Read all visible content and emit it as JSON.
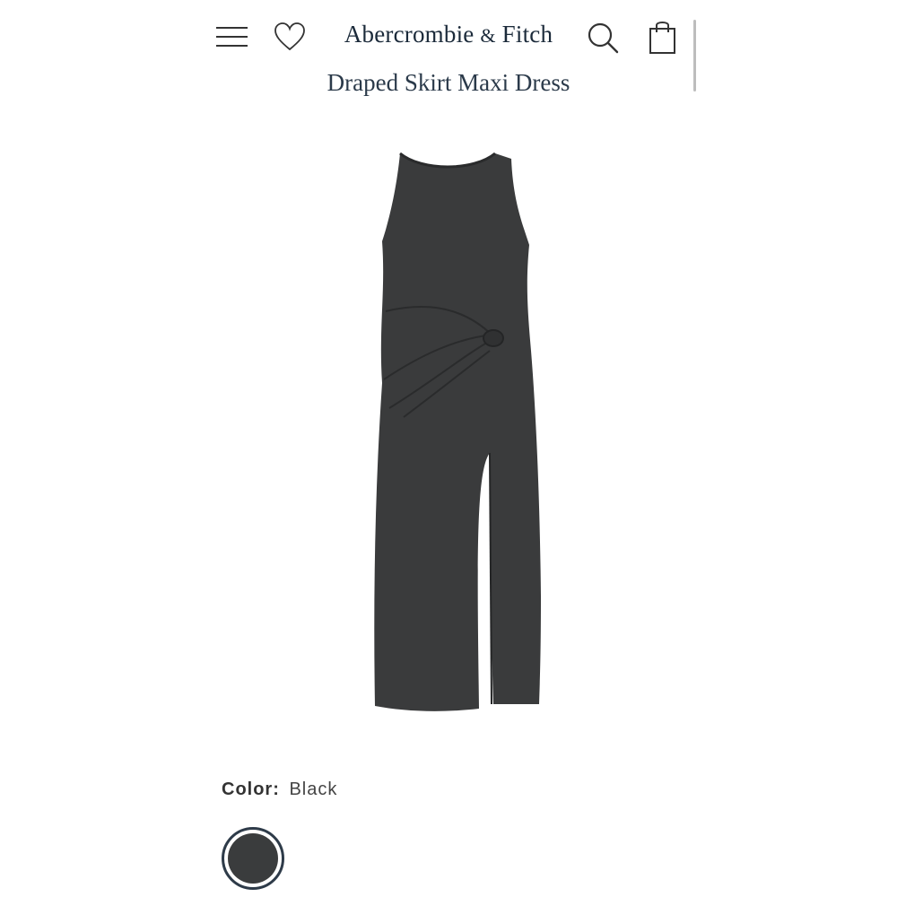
{
  "header": {
    "brand": "Abercrombie",
    "brand_amp": "&",
    "brand_suffix": "Fitch",
    "product_title": "Draped Skirt Maxi Dress",
    "icons": [
      "menu-icon",
      "heart-icon",
      "search-icon",
      "shopping-bag-icon"
    ]
  },
  "product": {
    "image_alt": "black sleeveless draped maxi dress with side knot and slit",
    "color_label": "Color:",
    "color_value": "Black",
    "swatch_color": "#3a3c3d",
    "accent_color": "#2e3b49"
  }
}
